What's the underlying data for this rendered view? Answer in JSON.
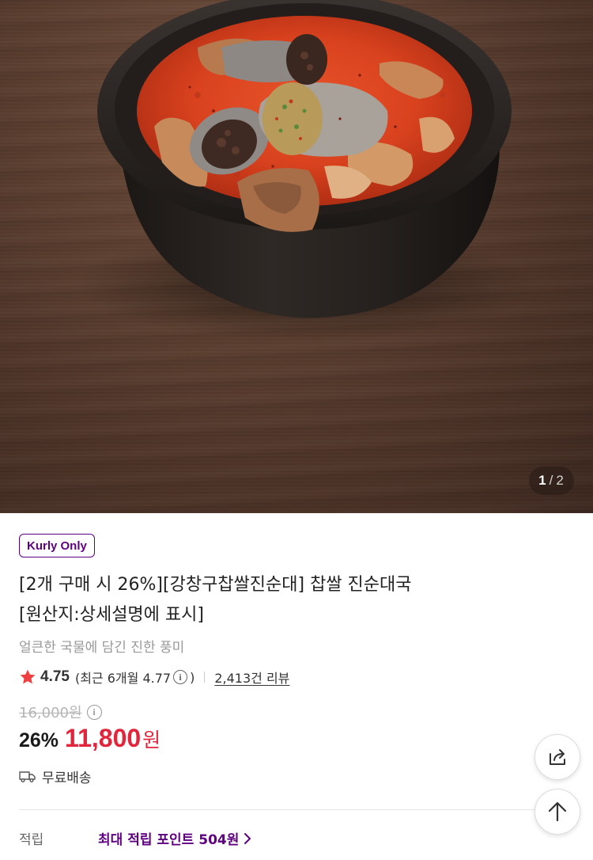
{
  "hero": {
    "image_alt": "찹쌀 진순대국",
    "counter": {
      "current": "1",
      "separator": "/",
      "total": "2"
    }
  },
  "product": {
    "badge": "Kurly Only",
    "title_line1": "[2개 구매 시 26%][강창구찹쌀진순대] 찹쌀 진순대국",
    "title_line2": "[원산지:상세설명에 표시]",
    "subtitle": "얼큰한 국물에 담긴 진한 풍미",
    "rating": {
      "score": "4.75",
      "recent_prefix": "(최근 6개월 4.77",
      "info_glyph": "i",
      "recent_suffix": ")",
      "reviews": "2,413건 리뷰"
    },
    "original_price": "16,000원",
    "discount_rate": "26%",
    "price": "11,800",
    "currency": "원",
    "delivery": "무료배송",
    "points": {
      "label": "적립",
      "value": "최대 적립 포인트 504원"
    }
  },
  "icons": {
    "star": "star-icon",
    "info": "info-icon",
    "truck": "truck-icon",
    "share": "share-icon",
    "arrow_up": "arrow-up-icon",
    "chevron": "chevron-right-icon"
  },
  "colors": {
    "brand_purple": "#5f0080",
    "price_red": "#e0253c",
    "star_red": "#f03f40"
  }
}
